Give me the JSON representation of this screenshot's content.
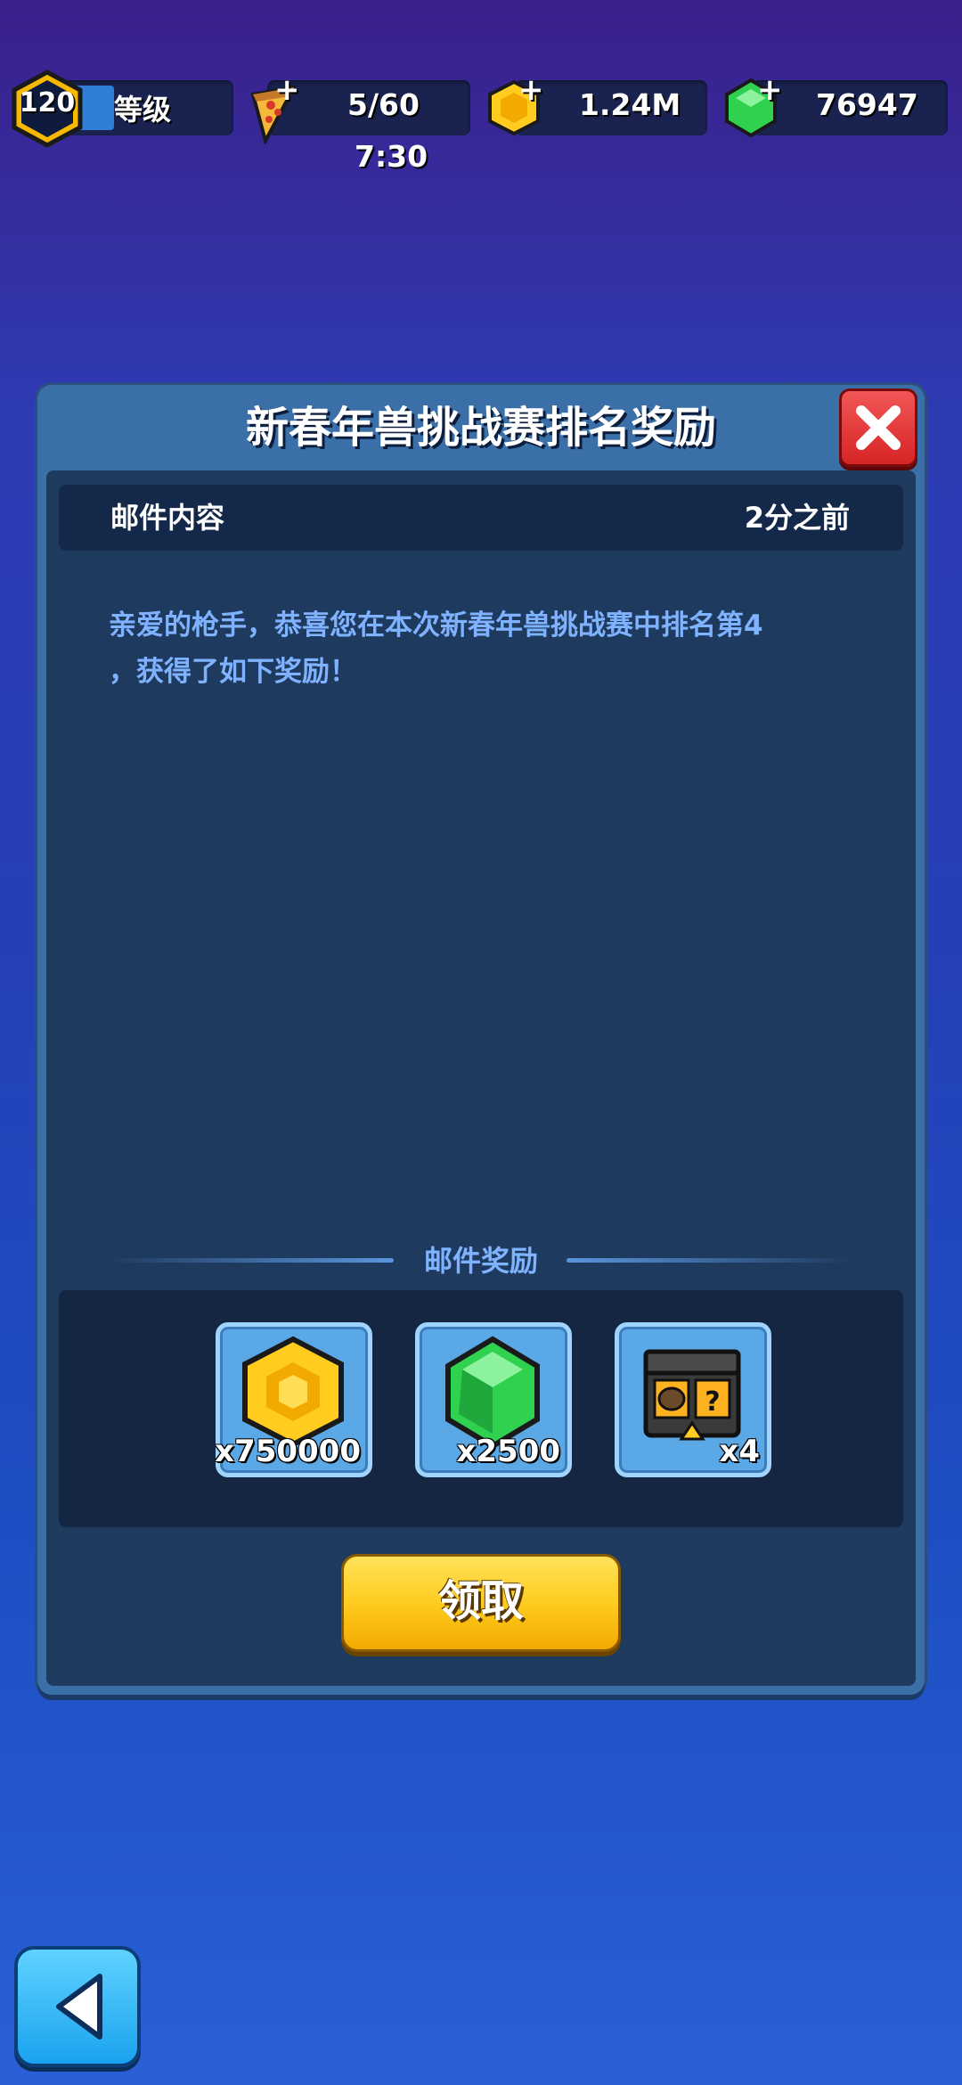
{
  "hud": {
    "level": {
      "value": "120",
      "label": "等级",
      "progress": 0.28
    },
    "energy": {
      "value": "5/60",
      "timer": "7:30"
    },
    "coins": {
      "value": "1.24M"
    },
    "gems": {
      "value": "76947"
    }
  },
  "dialog": {
    "title": "新春年兽挑战赛排名奖励",
    "mail_header_label": "邮件内容",
    "mail_time": "2分之前",
    "mail_body_line1": "亲爱的枪手，恭喜您在本次新春年兽挑战赛中排名第4",
    "mail_body_line2": "，获得了如下奖励！",
    "rewards_title": "邮件奖励",
    "rewards": [
      {
        "icon": "gold-coin-icon",
        "qty": "x750000"
      },
      {
        "icon": "green-gem-icon",
        "qty": "x2500"
      },
      {
        "icon": "mystery-crate-icon",
        "qty": "x4"
      }
    ],
    "claim_label": "领取"
  },
  "colors": {
    "accent_yellow": "#ffcc1f",
    "close_red": "#d62424",
    "text_blue": "#7fb3ff"
  }
}
